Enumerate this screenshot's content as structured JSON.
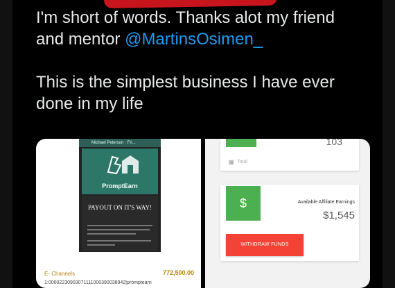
{
  "tweet": {
    "line1": "I'm short of words. Thanks alot my friend",
    "line2_prefix": "and mentor ",
    "mention": "@MartinsOsimen_",
    "line3": "This is the simplest business I have ever",
    "line4": "done in my life"
  },
  "media_left": {
    "chat_header": "Michael Peterson · Fri...",
    "logo_icon": "promptearn-logo-icon",
    "logo_text": "PromptEarn",
    "payout_title": "PAYOUT ON IT'S WAY!",
    "ledger_name": "E- Channels",
    "ledger_amount": "772,500.00",
    "ledger_reference": "1:00002230903071111000390038942|promptearn"
  },
  "media_right": {
    "top_count": "103",
    "total_label": "Total",
    "calendar_icon": "calendar-icon",
    "dollar_symbol": "$",
    "earnings_label": "Available Affiliate Earnings",
    "earnings_value": "$1,545",
    "withdraw_label": "WITHDRAW FUNDS"
  },
  "colors": {
    "background": "#000000",
    "tweet_text": "#e7e9ea",
    "mention": "#1d9bf0",
    "green": "#4caf50",
    "red": "#f44336",
    "logo_teal": "#2c7768"
  }
}
